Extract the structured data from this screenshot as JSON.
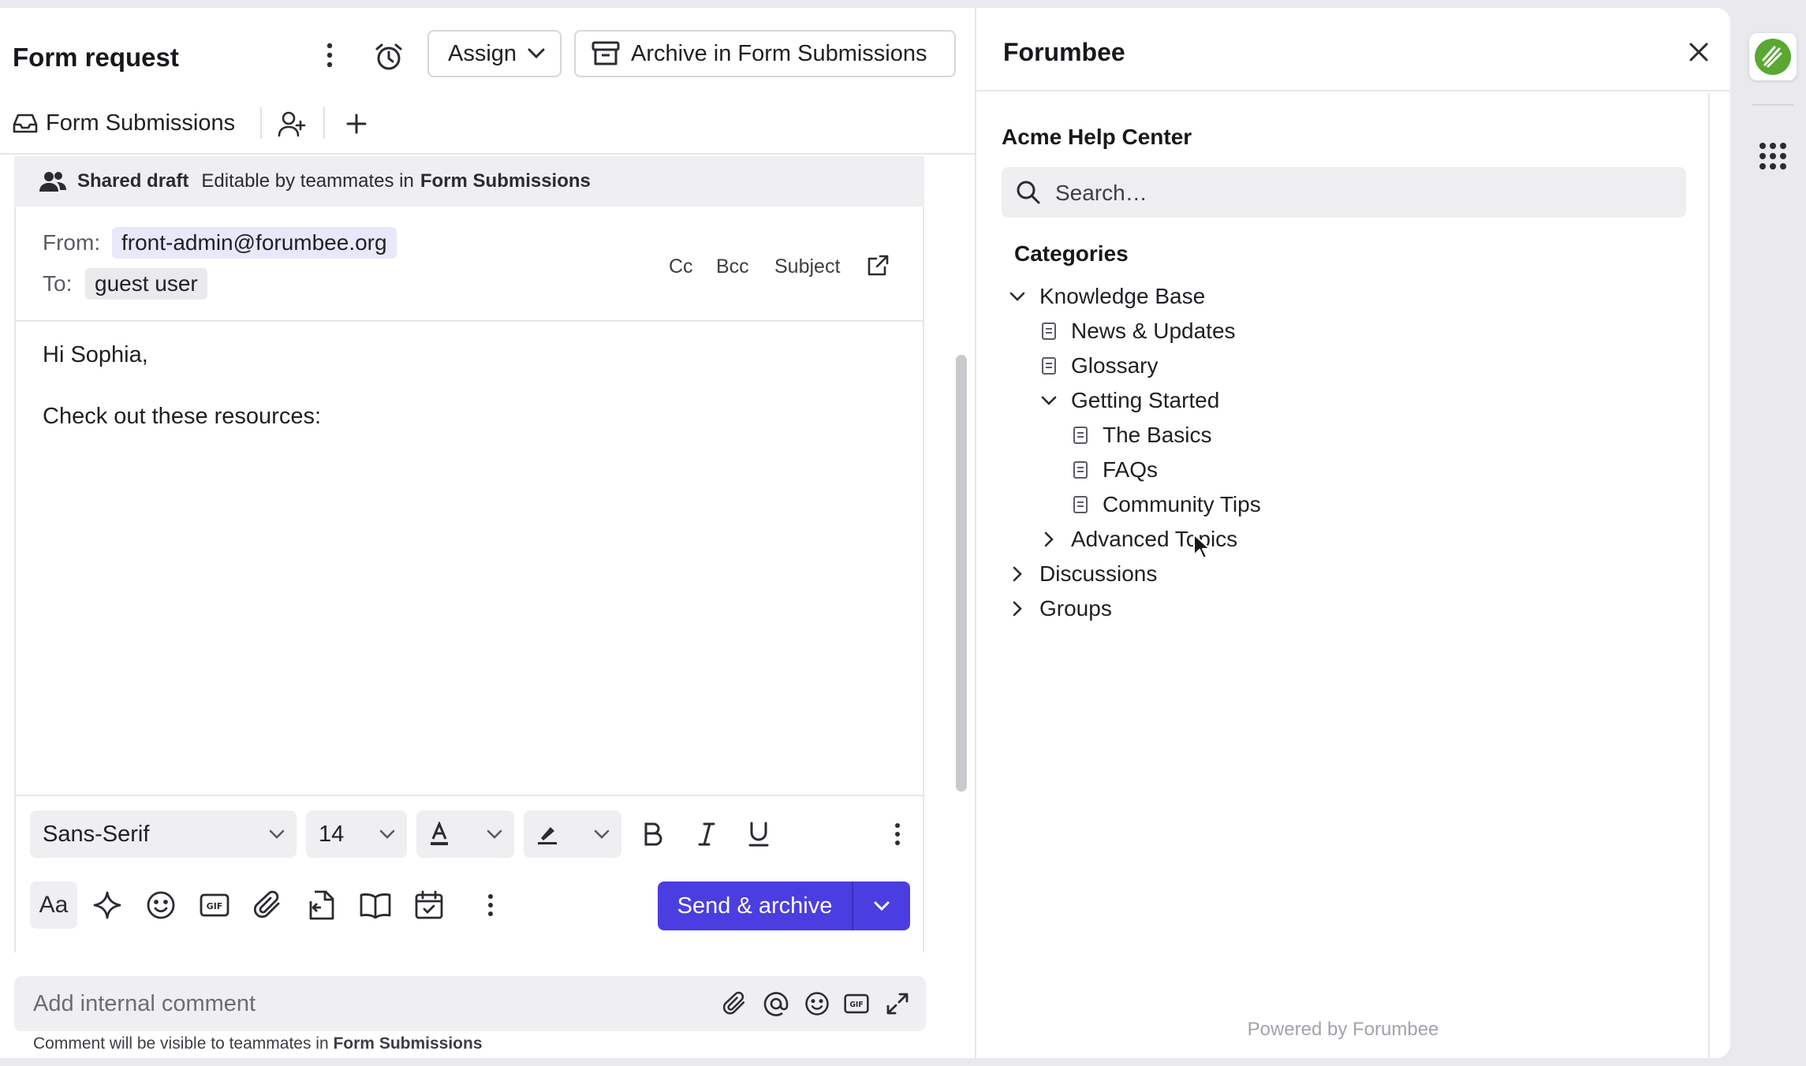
{
  "conversation": {
    "title": "Form request",
    "assign_label": "Assign",
    "archive_label": "Archive in Form Submissions",
    "inbox_label": "Form Submissions"
  },
  "draft": {
    "shared_title": "Shared draft",
    "shared_desc": "Editable by teammates in",
    "shared_inbox": "Form Submissions",
    "from_label": "From:",
    "from_value": "front-admin@forumbee.org",
    "to_label": "To:",
    "to_value": "guest user",
    "cc": "Cc",
    "bcc": "Bcc",
    "subject": "Subject",
    "body_line1": "Hi Sophia,",
    "body_line2": "Check out these resources:"
  },
  "formatting": {
    "font": "Sans-Serif",
    "size": "14"
  },
  "actions": {
    "aa_label": "Aa",
    "send_label": "Send & archive"
  },
  "comment": {
    "placeholder": "Add internal comment",
    "note_prefix": "Comment will be visible to teammates in",
    "note_inbox": "Form Submissions"
  },
  "sidebar": {
    "title": "Forumbee",
    "help_center": "Acme Help Center",
    "search_placeholder": "Search…",
    "categories_label": "Categories",
    "tree": [
      {
        "label": "Knowledge Base",
        "type": "folder",
        "state": "expanded"
      },
      {
        "label": "News & Updates",
        "type": "page"
      },
      {
        "label": "Glossary",
        "type": "page"
      },
      {
        "label": "Getting Started",
        "type": "folder",
        "state": "expanded"
      },
      {
        "label": "The Basics",
        "type": "page"
      },
      {
        "label": "FAQs",
        "type": "page"
      },
      {
        "label": "Community Tips",
        "type": "page"
      },
      {
        "label": "Advanced Topics",
        "type": "folder",
        "state": "collapsed"
      },
      {
        "label": "Discussions",
        "type": "folder",
        "state": "collapsed"
      },
      {
        "label": "Groups",
        "type": "folder",
        "state": "collapsed"
      }
    ],
    "powered_by": "Powered by Forumbee"
  },
  "colors": {
    "accent": "#4b3ee0",
    "from_chip": "#e8e8fb",
    "logo_green": "#5aa832"
  }
}
